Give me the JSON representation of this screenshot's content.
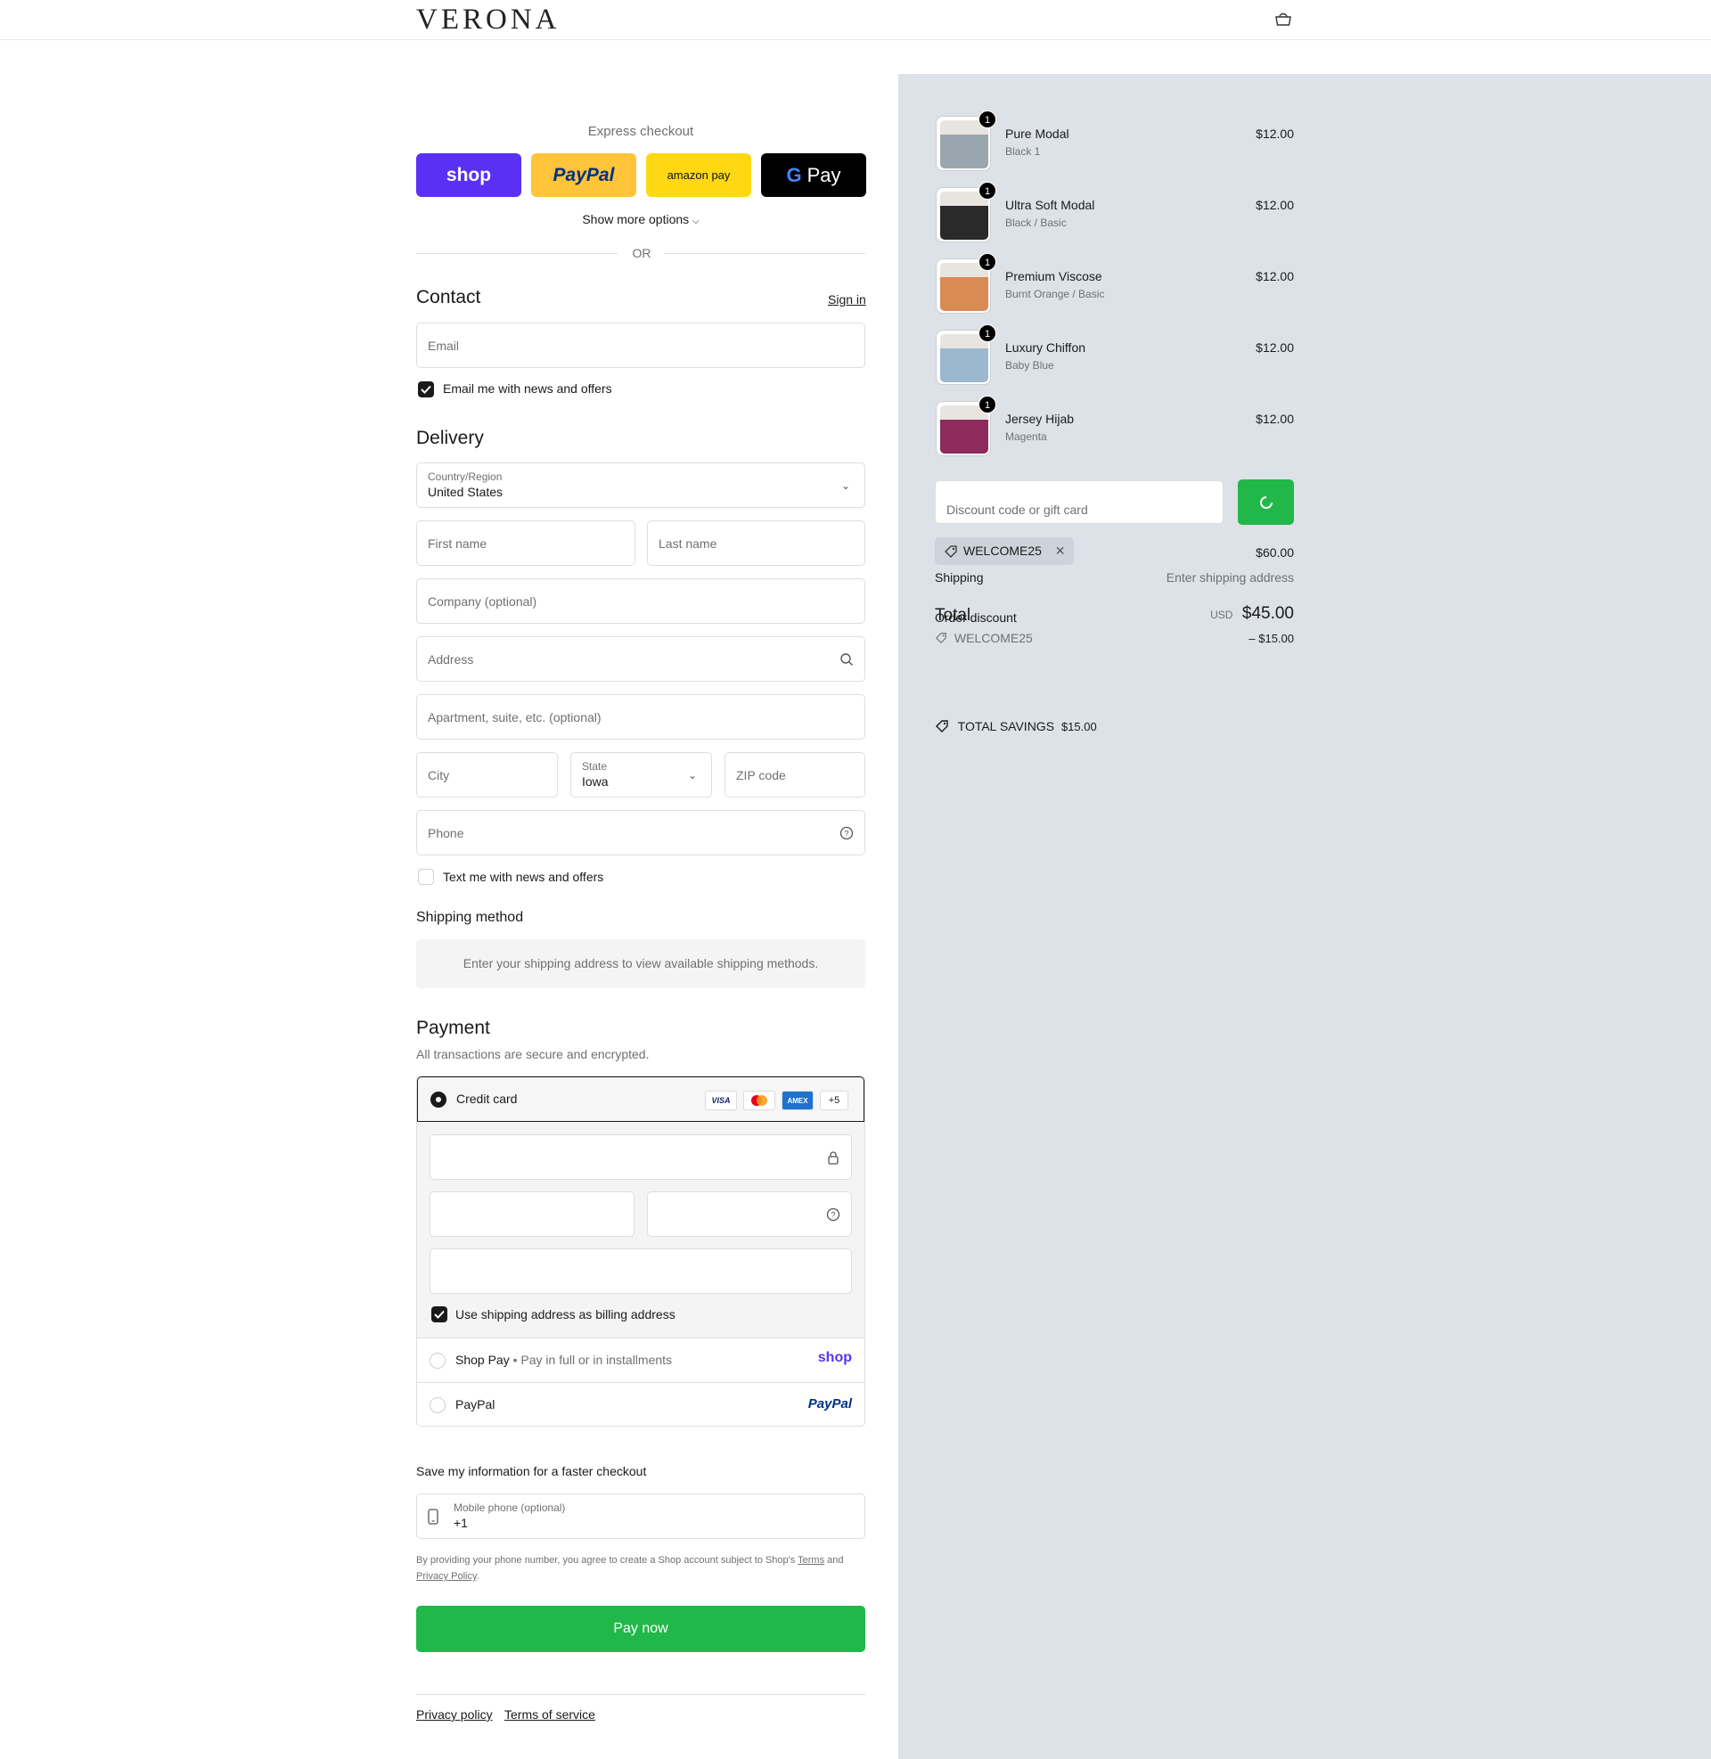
{
  "brand": {
    "logo": "VERONA"
  },
  "express": {
    "title": "Express checkout",
    "shop_label": "shop",
    "paypal_label": "PayPal",
    "amazon_label": "amazon pay",
    "gpay_label": "Pay",
    "more_options": "Show more options",
    "or": "OR"
  },
  "contact": {
    "heading": "Contact",
    "sign_in": "Sign in",
    "email_placeholder": "Email",
    "news_checkbox": "Email me with news and offers"
  },
  "delivery": {
    "heading": "Delivery",
    "country_label": "Country/Region",
    "country_value": "United States",
    "first_name": "First name",
    "last_name": "Last name",
    "company": "Company (optional)",
    "address": "Address",
    "apartment": "Apartment, suite, etc. (optional)",
    "city": "City",
    "state_label": "State",
    "state_value": "Iowa",
    "zip": "ZIP code",
    "phone": "Phone",
    "text_checkbox": "Text me with news and offers"
  },
  "shipping_method": {
    "heading": "Shipping method",
    "message": "Enter your shipping address to view available shipping methods."
  },
  "payment": {
    "heading": "Payment",
    "subtitle": "All transactions are secure and encrypted.",
    "credit_card": "Credit card",
    "card_logos": [
      "VISA",
      "MC",
      "AMEX"
    ],
    "more_cards": "+5",
    "billing_checkbox": "Use shipping address as billing address",
    "shop_pay": "Shop Pay",
    "shop_pay_desc": "Pay in full or in installments",
    "shop_pay_logo": "shop",
    "paypal": "PayPal",
    "paypal_logo": "PayPal"
  },
  "save_info": {
    "heading": "Save my information for a faster checkout",
    "mobile_label": "Mobile phone (optional)",
    "mobile_value": "+1",
    "legal_prefix": "By providing your phone number, you agree to create a Shop account subject to Shop's",
    "terms": "Terms",
    "and": "and",
    "privacy": "Privacy Policy",
    "period": "."
  },
  "pay_now": "Pay now",
  "footer": {
    "privacy": "Privacy policy",
    "terms": "Terms of service"
  },
  "summary": {
    "items": [
      {
        "name": "Pure Modal",
        "variant": "Black 1",
        "price": "$12.00",
        "qty": "1",
        "color": "#9aa6ad"
      },
      {
        "name": "Ultra Soft Modal",
        "variant": "Black / Basic",
        "price": "$12.00",
        "qty": "1",
        "color": "#2a2a2a"
      },
      {
        "name": "Premium Viscose",
        "variant": "Burnt Orange / Basic",
        "price": "$12.00",
        "qty": "1",
        "color": "#d98a55"
      },
      {
        "name": "Luxury Chiffon",
        "variant": "Baby Blue",
        "price": "$12.00",
        "qty": "1",
        "color": "#9cb8cf"
      },
      {
        "name": "Jersey Hijab",
        "variant": "Magenta",
        "price": "$12.00",
        "qty": "1",
        "color": "#8c2b5c"
      }
    ],
    "discount_placeholder": "Discount code or gift card",
    "applied_code": "WELCOME25",
    "subtotal_value": "$60.00",
    "shipping_label": "Shipping",
    "shipping_value": "Enter shipping address",
    "total_label": "Total",
    "currency": "USD",
    "total_value": "$45.00",
    "order_discount_label": "Order discount",
    "order_discount_code": "WELCOME25",
    "order_discount_value": "– $15.00",
    "savings_label": "TOTAL SAVINGS",
    "savings_value": "$15.00"
  }
}
